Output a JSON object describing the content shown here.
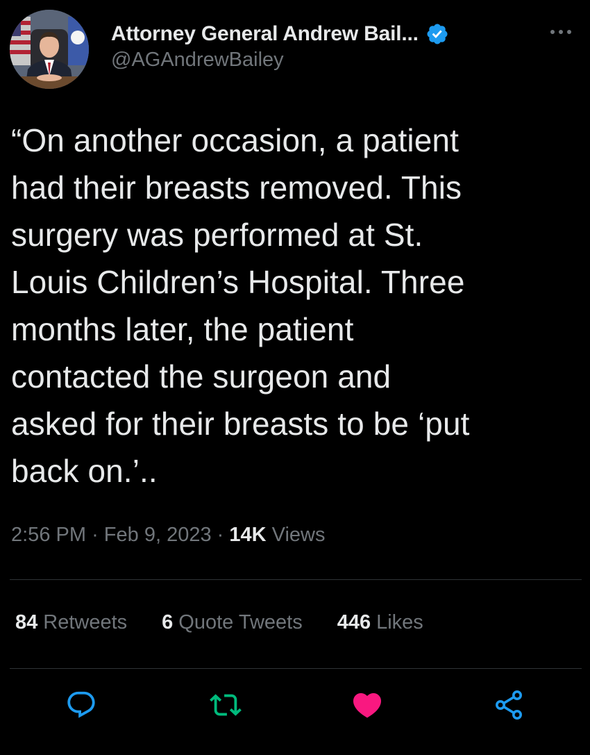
{
  "author": {
    "display_name": "Attorney General Andrew Bail...",
    "handle": "@AGAndrewBailey",
    "verified_icon": "verified-badge-icon",
    "more_icon": "more-options-icon"
  },
  "tweet": {
    "text": "“On another occasion, a patient\nhad their breasts removed. This\nsurgery was performed at St.\nLouis Children’s Hospital. Three\nmonths later, the patient\ncontacted the surgeon and\nasked for their breasts to be ‘put\nback on.’..",
    "time": "2:56 PM",
    "separator": "·",
    "date": "Feb 9, 2023",
    "views_count": "14K",
    "views_label": "Views"
  },
  "stats": {
    "retweets_count": "84",
    "retweets_label": "Retweets",
    "quotes_count": "6",
    "quotes_label": "Quote Tweets",
    "likes_count": "446",
    "likes_label": "Likes"
  },
  "actions": {
    "reply_icon": "reply-icon",
    "retweet_icon": "retweet-icon",
    "like_icon": "heart-icon",
    "share_icon": "share-icon"
  },
  "colors": {
    "background": "#000000",
    "text_primary": "#e7e9ea",
    "text_secondary": "#71767b",
    "verified_blue": "#1d9bf0",
    "retweet_green": "#00ba7c",
    "like_pink": "#f91880",
    "divider": "#2f3336"
  }
}
